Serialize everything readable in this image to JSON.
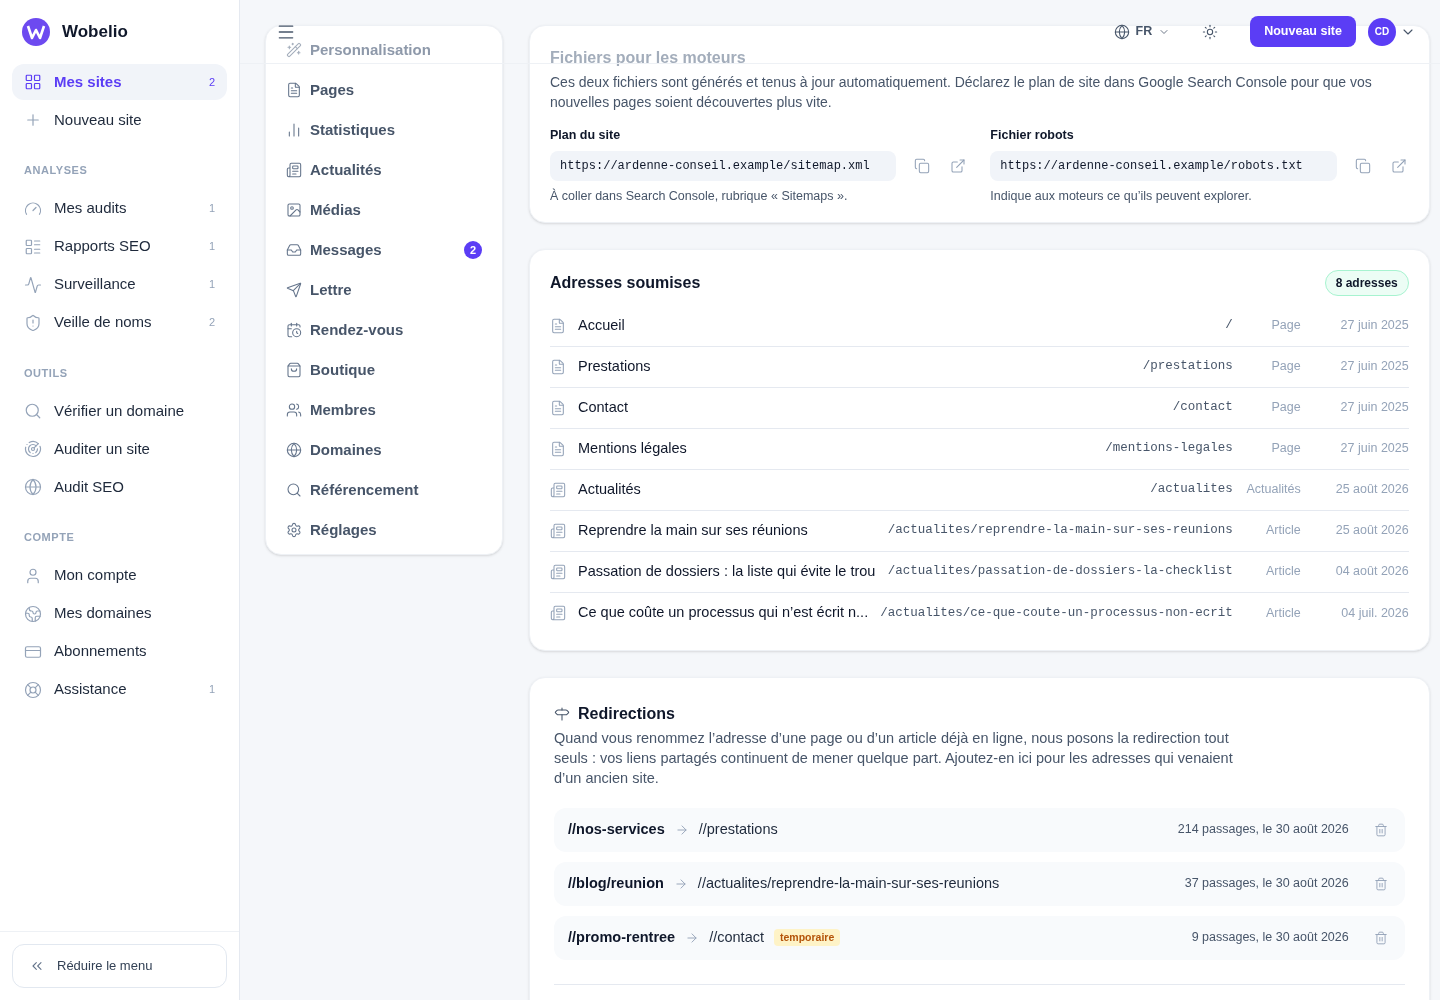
{
  "sidebar": {
    "brand": "Wobelio",
    "primary": [
      {
        "label": "Mes sites",
        "count": "2",
        "selected": true
      },
      {
        "label": "Nouveau site",
        "selected": false
      }
    ],
    "sections": [
      {
        "title": "ANALYSES",
        "items": [
          {
            "label": "Mes audits",
            "count": "1"
          },
          {
            "label": "Rapports SEO",
            "count": "1"
          },
          {
            "label": "Surveillance",
            "count": "1"
          },
          {
            "label": "Veille de noms",
            "count": "2"
          }
        ]
      },
      {
        "title": "OUTILS",
        "items": [
          {
            "label": "Vérifier un domaine"
          },
          {
            "label": "Auditer un site"
          },
          {
            "label": "Audit SEO"
          }
        ]
      },
      {
        "title": "COMPTE",
        "items": [
          {
            "label": "Mon compte"
          },
          {
            "label": "Mes domaines"
          },
          {
            "label": "Abonnements"
          },
          {
            "label": "Assistance",
            "count": "1"
          }
        ]
      }
    ],
    "collapse_button": "Réduire le menu"
  },
  "header": {
    "language": "FR",
    "new_site_button": "Nouveau site",
    "avatar": "CD"
  },
  "site_nav": {
    "items": [
      {
        "label": "Personnalisation"
      },
      {
        "label": "Pages"
      },
      {
        "label": "Statistiques"
      },
      {
        "label": "Actualités"
      },
      {
        "label": "Médias"
      },
      {
        "label": "Messages",
        "badge": "2"
      },
      {
        "label": "Lettre"
      },
      {
        "label": "Rendez-vous"
      },
      {
        "label": "Boutique"
      },
      {
        "label": "Membres"
      },
      {
        "label": "Domaines"
      },
      {
        "label": "Référencement"
      },
      {
        "label": "Réglages"
      }
    ]
  },
  "files_card": {
    "title": "Fichiers pour les moteurs",
    "description": "Ces deux fichiers sont générés et tenus à jour automatiquement. Déclarez le plan de site dans Google Search Console pour que vos nouvelles pages soient découvertes plus vite.",
    "files": [
      {
        "label": "Plan du site",
        "url": "https://ardenne-conseil.example/sitemap.xml",
        "hint": "À coller dans Search Console, rubrique « Sitemaps »."
      },
      {
        "label": "Fichier robots",
        "url": "https://ardenne-conseil.example/robots.txt",
        "hint": "Indique aux moteurs ce qu’ils peuvent explorer."
      }
    ]
  },
  "addresses_card": {
    "title": "Adresses soumises",
    "badge": "8 adresses",
    "rows": [
      {
        "kind": "page",
        "title": "Accueil",
        "path": "/",
        "type": "Page",
        "date": "27 juin 2025"
      },
      {
        "kind": "page",
        "title": "Prestations",
        "path": "/prestations",
        "type": "Page",
        "date": "27 juin 2025"
      },
      {
        "kind": "page",
        "title": "Contact",
        "path": "/contact",
        "type": "Page",
        "date": "27 juin 2025"
      },
      {
        "kind": "page",
        "title": "Mentions légales",
        "path": "/mentions-legales",
        "type": "Page",
        "date": "27 juin 2025"
      },
      {
        "kind": "news",
        "title": "Actualités",
        "path": "/actualites",
        "type": "Actualités",
        "date": "25 août 2026"
      },
      {
        "kind": "news",
        "title": "Reprendre la main sur ses réunions",
        "path": "/actualites/reprendre-la-main-sur-ses-reunions",
        "type": "Article",
        "date": "25 août 2026"
      },
      {
        "kind": "news",
        "title": "Passation de dossiers : la liste qui évite le trou",
        "path": "/actualites/passation-de-dossiers-la-checklist",
        "type": "Article",
        "date": "04 août 2026"
      },
      {
        "kind": "news",
        "title": "Ce que coûte un processus qui n’est écrit n...",
        "path": "/actualites/ce-que-coute-un-processus-non-ecrit",
        "type": "Article",
        "date": "04 juil. 2026"
      }
    ]
  },
  "redirects_card": {
    "title": "Redirections",
    "description": "Quand vous renommez l’adresse d’une page ou d’un article déjà en ligne, nous posons la redirection tout seuls : vos liens partagés continuent de mener quelque part. Ajoutez-en ici pour les adresses qui venaient d’un ancien site.",
    "rows": [
      {
        "from": "//nos-services",
        "to": "//prestations",
        "stats": "214 passages, le 30 août 2026"
      },
      {
        "from": "//blog/reunion",
        "to": "//actualites/reprendre-la-main-sur-ses-reunions",
        "stats": "37 passages, le 30 août 2026"
      },
      {
        "from": "//promo-rentree",
        "to": "//contact",
        "tag": "temporaire",
        "stats": "9 passages, le 30 août 2026"
      }
    ]
  }
}
